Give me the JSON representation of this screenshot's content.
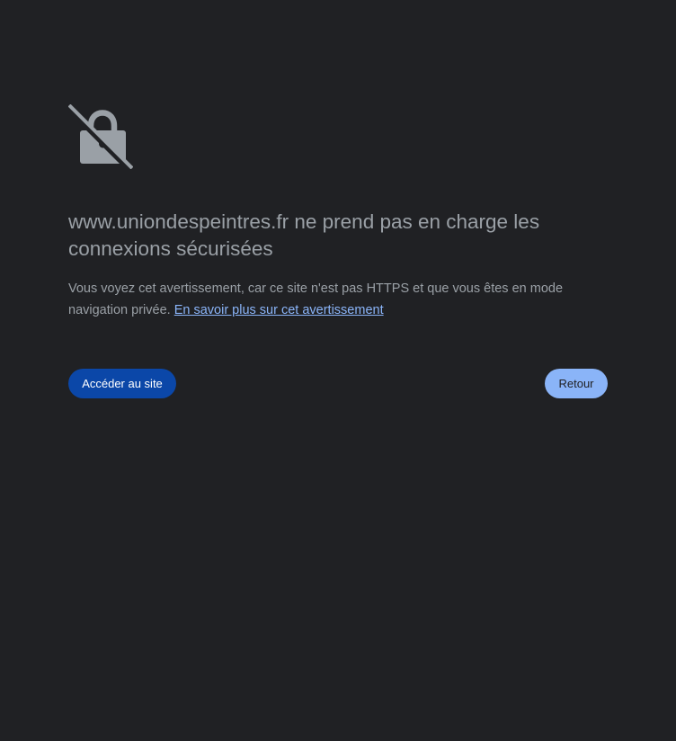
{
  "page": {
    "heading": "www.uniondespeintres.fr ne prend pas en charge les connexions sécurisées",
    "explanation": "Vous voyez cet avertissement, car ce site n'est pas HTTPS et que vous êtes en mode navigation privée.",
    "learn_more_link": "En savoir plus sur cet avertissement"
  },
  "buttons": {
    "proceed_label": "Accéder au site",
    "back_label": "Retour"
  },
  "icons": {
    "main": "lock-slash-icon"
  },
  "colors": {
    "background": "#202124",
    "text": "#9aa0a6",
    "link": "#8ab4f8",
    "proceed_button": "#0b47a8",
    "back_button": "#8ab4f8"
  }
}
